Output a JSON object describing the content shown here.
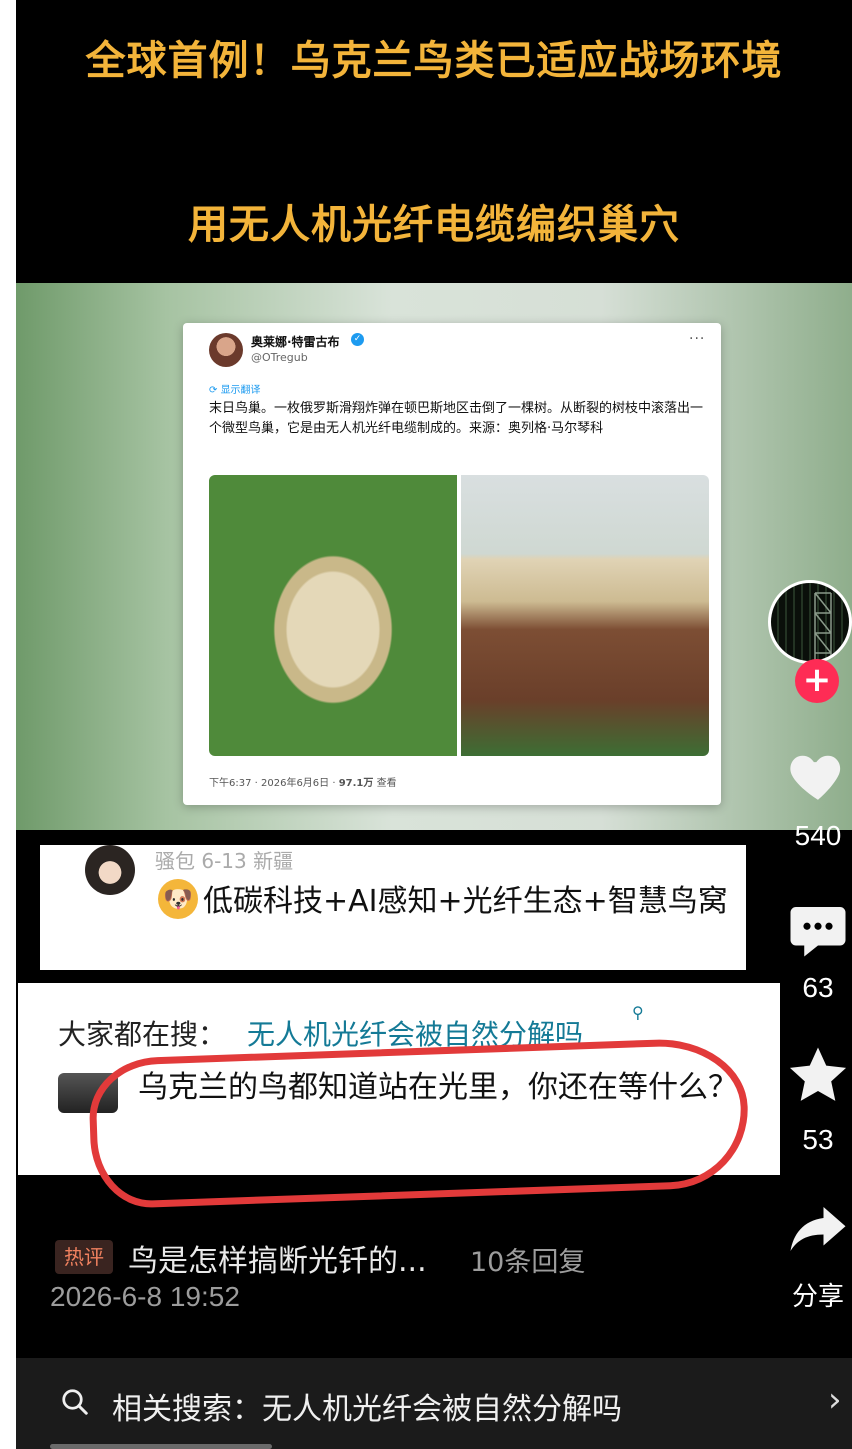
{
  "header": {
    "headline_1": "全球首例！乌克兰鸟类已适应战场环境",
    "headline_2": "用无人机光纤电缆编织巢穴"
  },
  "tweet": {
    "author_name": "奥莱娜·特雷古布",
    "handle": "@OTregub",
    "translate_label": "显示翻译",
    "body": "末日鸟巢。一枚俄罗斯滑翔炸弹在顿巴斯地区击倒了一棵树。从断裂的树枝中滚落出一个微型鸟巢，它是由无人机光纤电缆制成的。来源：奥列格·马尔琴科",
    "footer_time": "下午6:37 · 2026年6月6日 · ",
    "footer_views": "97.1万",
    "footer_views_label": " 查看"
  },
  "actions": {
    "like_count": "540",
    "comment_count": "63",
    "favorite_count": "53",
    "share_label": "分享",
    "follow_symbol": "+"
  },
  "comment1": {
    "meta": "骚包  6-13  新疆",
    "text": "低碳科技+AI感知+光纤生态+智慧鸟窝"
  },
  "comment2": {
    "everyone_searching_label": "大家都在搜：",
    "search_suggestion": "无人机光纤会被自然分解吗",
    "text": "乌克兰的鸟都知道站在光里，你还在等什么？"
  },
  "hot_comment": {
    "badge": "热评",
    "text": "鸟是怎样搞断光钎的...",
    "replies": "10条回复",
    "timestamp": "2026-6-8 19:52"
  },
  "bottom_search": {
    "label": "相关搜索：无人机光纤会被自然分解吗"
  },
  "colors": {
    "headline": "#f3b43a",
    "accent_red": "#fe2c55",
    "link": "#147a96",
    "ring": "#e23a3a"
  }
}
